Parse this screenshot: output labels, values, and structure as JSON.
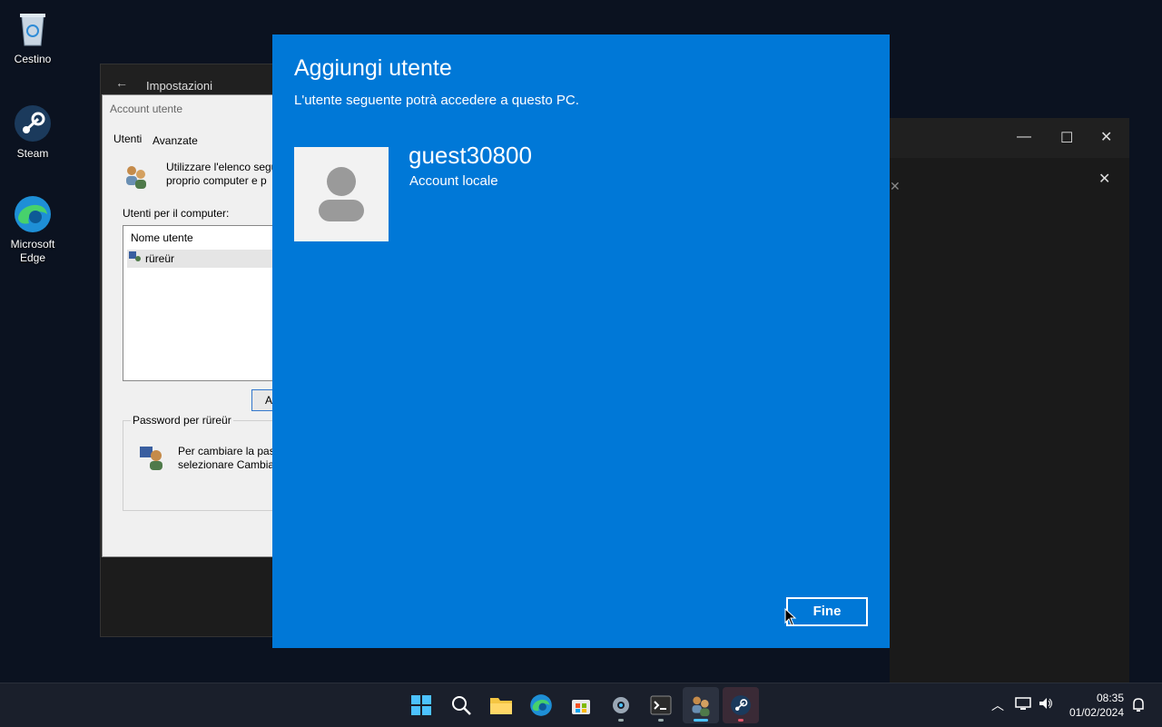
{
  "desktop": {
    "icons": [
      {
        "label": "Cestino"
      },
      {
        "label": "Steam"
      },
      {
        "label": "Microsoft Edge"
      }
    ]
  },
  "settings_window": {
    "title": "Impostazioni"
  },
  "user_accounts_dialog": {
    "title": "Account utente",
    "tabs": [
      "Utenti",
      "Avanzate"
    ],
    "intro_text": "Utilizzare l'elenco segu proprio computer e p",
    "users_label": "Utenti per il computer:",
    "list_header": "Nome utente",
    "users": [
      "rüreür"
    ],
    "add_button_label": "A",
    "password_group_title": "Password per rüreür",
    "password_text": "Per cambiare la pas selezionare Cambia"
  },
  "modal": {
    "title": "Aggiungi utente",
    "subtitle": "L'utente seguente potrà accedere a questo PC.",
    "username": "guest30800",
    "account_type": "Account locale",
    "done_button": "Fine"
  },
  "taskbar": {
    "apps": [
      "start-icon",
      "search-icon",
      "file-explorer-icon",
      "edge-icon",
      "store-icon",
      "settings-icon",
      "terminal-icon",
      "user-accounts-icon",
      "steam-icon"
    ],
    "time": "08:35",
    "date": "01/02/2024"
  },
  "colors": {
    "modal_bg": "#0078d7",
    "taskbar_bg": "#1a1f2b",
    "accent": "#4cc2ff"
  }
}
